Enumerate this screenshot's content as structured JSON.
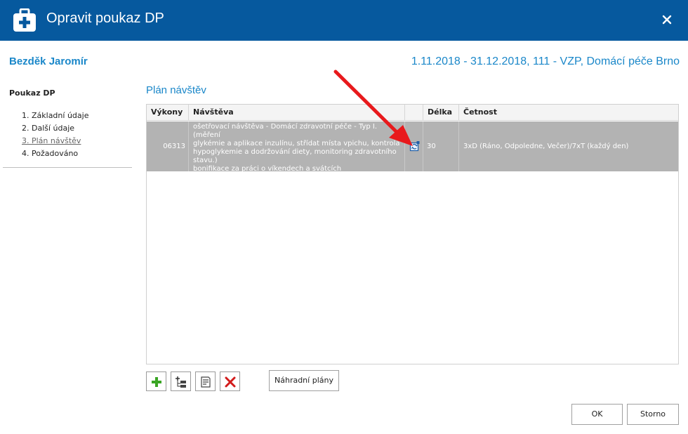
{
  "window": {
    "title": "Opravit poukaz DP",
    "icon": "medical-kit-icon",
    "close_icon": "close-icon"
  },
  "header": {
    "patient_name": "Bezděk Jaromír",
    "period": "1.11.2018 - 31.12.2018, 111 - VZP, Domácí péče Brno"
  },
  "sidebar": {
    "title": "Poukaz DP",
    "items": [
      {
        "label": "1. Základní údaje"
      },
      {
        "label": "2. Další údaje"
      },
      {
        "label": "3. Plán návštěv",
        "active": true
      },
      {
        "label": "4. Požadováno"
      }
    ]
  },
  "main": {
    "section_title": "Plán návštěv",
    "grid": {
      "columns": [
        "Výkony",
        "Návštěva",
        "",
        "Délka",
        "Četnost"
      ],
      "rows": [
        {
          "code": "06313",
          "visit_lines": [
            "ošetřovací návštěva - Domácí zdravotní péče - Typ I. (měření",
            "glykémie a aplikace inzulínu, střídat místa vpichu, kontrola",
            "hypoglykemie a dodržování diety, monitoring zdravotního",
            "stavu.)",
            "bonifikace za práci o víkendech a svátcích"
          ],
          "icon": "replace-plan-icon",
          "length": "30",
          "frequency": "3xD (Ráno, Odpoledne, Večer)/7xT (každý den)"
        }
      ]
    },
    "toolbar": {
      "add_icon": "add-icon",
      "add_child_icon": "add-subitem-icon",
      "edit_icon": "edit-icon",
      "delete_icon": "delete-icon",
      "replacement_plans_label": "Náhradní plány"
    }
  },
  "footer": {
    "ok_label": "OK",
    "cancel_label": "Storno"
  },
  "colors": {
    "titlebar": "#06599e",
    "accent": "#1a87c9",
    "selected_row": "#b3b3b3",
    "annotation_arrow": "#e8191c"
  }
}
